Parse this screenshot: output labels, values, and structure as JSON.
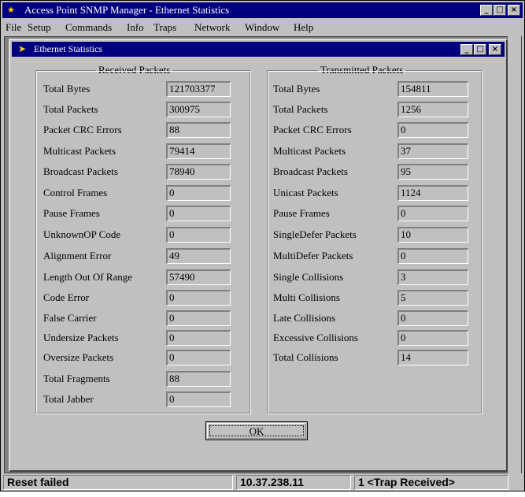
{
  "window": {
    "title": "Access Point SNMP Manager -  Ethernet Statistics"
  },
  "menu": [
    "File",
    "Setup",
    "Commands",
    "Info",
    "Traps",
    "Network",
    "Window",
    "Help"
  ],
  "child_window": {
    "title": "Ethernet Statistics"
  },
  "received": {
    "title": "Received Packets",
    "rows": [
      {
        "label": "Total Bytes",
        "value": "121703377"
      },
      {
        "label": "Total Packets",
        "value": "300975"
      },
      {
        "label": "Packet CRC Errors",
        "value": "88"
      },
      {
        "label": "Multicast Packets",
        "value": "79414"
      },
      {
        "label": "Broadcast Packets",
        "value": "78940"
      },
      {
        "label": "Control Frames",
        "value": "0"
      },
      {
        "label": "Pause Frames",
        "value": "0"
      },
      {
        "label": "UnknownOP Code",
        "value": "0"
      },
      {
        "label": "Alignment Error",
        "value": "49"
      },
      {
        "label": "Length Out Of Range",
        "value": "57490"
      },
      {
        "label": "Code Error",
        "value": "0"
      },
      {
        "label": "False Carrier",
        "value": "0"
      },
      {
        "label": "Undersize Packets",
        "value": "0"
      },
      {
        "label": "Oversize Packets",
        "value": "0"
      },
      {
        "label": "Total Fragments",
        "value": "88"
      },
      {
        "label": "Total Jabber",
        "value": "0"
      }
    ]
  },
  "transmitted": {
    "title": "Transmitted Packets",
    "rows": [
      {
        "label": "Total Bytes",
        "value": "154811"
      },
      {
        "label": "Total Packets",
        "value": "1256"
      },
      {
        "label": "Packet CRC Errors",
        "value": "0"
      },
      {
        "label": "Multicast Packets",
        "value": "37"
      },
      {
        "label": "Broadcast Packets",
        "value": "95"
      },
      {
        "label": "Unicast Packets",
        "value": "1124"
      },
      {
        "label": "Pause Frames",
        "value": "0"
      },
      {
        "label": "SingleDefer Packets",
        "value": "10"
      },
      {
        "label": "MultiDefer Packets",
        "value": "0"
      },
      {
        "label": "Single Collisions",
        "value": "3"
      },
      {
        "label": "Multi Collisions",
        "value": "5"
      },
      {
        "label": "Late Collisions",
        "value": "0"
      },
      {
        "label": "Excessive Collisions",
        "value": "0"
      },
      {
        "label": "Total Collisions",
        "value": "14"
      }
    ]
  },
  "ok_label": "OK",
  "status": {
    "message": "Reset failed",
    "ip": "10.37.238.11",
    "traps": "1 <Trap Received>"
  },
  "window_buttons": {
    "minimize": "_",
    "maximize": "□",
    "close": "×"
  }
}
